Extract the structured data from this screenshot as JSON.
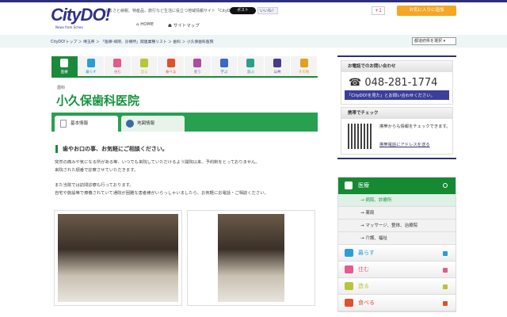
{
  "header": {
    "logo": "CityDO!",
    "logo_sub": "News from Scheo",
    "tagline": "ふるさと納税、特産品、旅行など生活に役立つ地域情報サイト「CityDO」",
    "nav": [
      "HOME",
      "サイトマップ"
    ],
    "x_post": "ポスト",
    "fb_like": "いいね！",
    "gplus": "+1",
    "favorite": "お気に入りに追加"
  },
  "breadcrumb": {
    "text": "CityDO!トップ ＞ 埼玉県 ＞ 「医療-病院、診療所」関連業種リスト ＞ 歯科 ＞ 小久保歯科医院",
    "pref_select": "都道府県を選択"
  },
  "categories": [
    {
      "label": "医療",
      "color": "#1a8a3a"
    },
    {
      "label": "暮らす",
      "color": "#2a9ed8"
    },
    {
      "label": "住む",
      "color": "#e45a8a"
    },
    {
      "label": "造る",
      "color": "#b8c43a"
    },
    {
      "label": "食べる",
      "color": "#e0502a"
    },
    {
      "label": "装う",
      "color": "#b04aa0"
    },
    {
      "label": "学ぶ",
      "color": "#3a6ac8"
    },
    {
      "label": "遊ぶ",
      "color": "#2aa08a"
    },
    {
      "label": "公共",
      "color": "#4a3a8a"
    },
    {
      "label": "その他",
      "color": "#e0a020"
    }
  ],
  "clinic": {
    "category": "歯科",
    "name": "小久保歯科医院"
  },
  "tabs": [
    "基本情報",
    "地図情報"
  ],
  "content": {
    "heading": "歯やお口の事、お気軽にご相談ください。",
    "paragraphs": [
      "突然の痛みや気になる所がある等、いつでも来院していただけるよう開院以来、予約制をとっておりません。",
      "来院された順番で診察させていただきます。",
      "また当院では訪問診療も行っております。",
      "自宅や施設等で療養されていて通院が困難な患者様がいらっしゃいましたら、お気軽にお電話・ご相談ください。"
    ]
  },
  "sidebar": {
    "phone_head": "お電話でのお問い合わせ",
    "phone": "☎ 048-281-1774",
    "phone_note": "「CityDO!を見た」とお問い合わせください。",
    "mobile_head": "携帯でチェック",
    "mobile_text": "携帯からも情報をチェックできます。",
    "mobile_link": "携帯電話にアドレスを送る",
    "menu_main": "医療",
    "submenu": [
      "→ 病院、診療所",
      "→ 薬局",
      "→ マッサージ、整体、治療院",
      "→ 介護、福祉"
    ],
    "menu": [
      {
        "label": "暮らす",
        "color": "#2a9ed8"
      },
      {
        "label": "住む",
        "color": "#e45a8a"
      },
      {
        "label": "造る",
        "color": "#b8c43a"
      },
      {
        "label": "食べる",
        "color": "#e0502a"
      }
    ]
  }
}
